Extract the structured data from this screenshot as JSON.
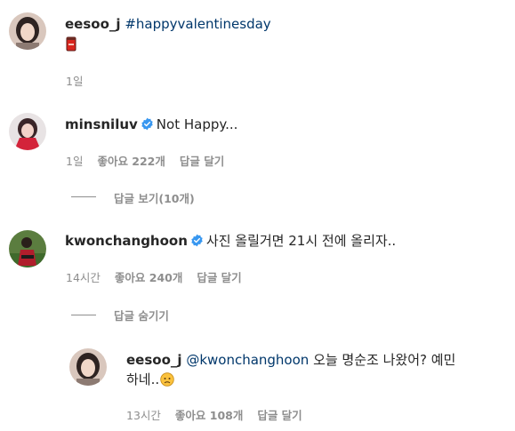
{
  "post": {
    "username": "eesoo_j",
    "caption": "#happyvalentinesday",
    "sticker_icon": "red-can-sticker-icon",
    "time": "1일"
  },
  "comments": [
    {
      "username": "minsniluv",
      "verified": true,
      "text": "Not Happy...",
      "time": "1일",
      "likes": "좋아요 222개",
      "reply": "답글 달기",
      "toggle": "답글 보기(10개)"
    },
    {
      "username": "kwonchanghoon",
      "verified": true,
      "text": "사진 올릴거면 21시 전에 올리자..",
      "time": "14시간",
      "likes": "좋아요 240개",
      "reply": "답글 달기",
      "toggle": "답글 숨기기",
      "replies": [
        {
          "username": "eesoo_j",
          "mention": "@kwonchanghoon",
          "text_line1": " 오늘 명순조 나왔어? 예민",
          "text_line2": "하네..",
          "emoji_icon": "worried-face-emoji-icon",
          "time": "13시간",
          "likes": "좋아요 108개",
          "reply": "답글 달기"
        }
      ]
    }
  ],
  "colors": {
    "username": "#262626",
    "link": "#00376b",
    "meta": "#8e8e8e",
    "verified": "#3897f0"
  }
}
